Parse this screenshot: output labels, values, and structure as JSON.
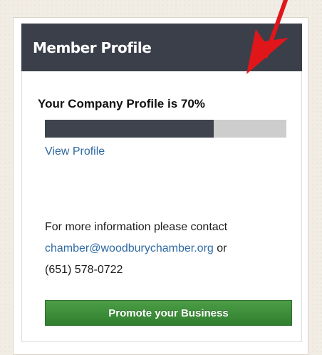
{
  "widget": {
    "title": "Member Profile",
    "profile_status": "Your Company Profile is 70%",
    "profile_progress": 0.7,
    "view_profile_link": "View Profile",
    "contact_text": "For more information please contact",
    "contact_email": "chamber@woodburychamber.org",
    "contact_or": "or",
    "contact_phone": "(651) 578-0722",
    "promote_button": "Promote your Business"
  },
  "icons": {
    "annotation_arrow": "red-arrow-icon"
  },
  "colors": {
    "header_bg": "#3a3f4a",
    "progress_fill": "#3f434d",
    "progress_track": "#cdcdcd",
    "link": "#2f6aa3",
    "button_green": "#2f7f2f",
    "arrow_red": "#e0161b",
    "page_bg": "#f1ede4"
  }
}
